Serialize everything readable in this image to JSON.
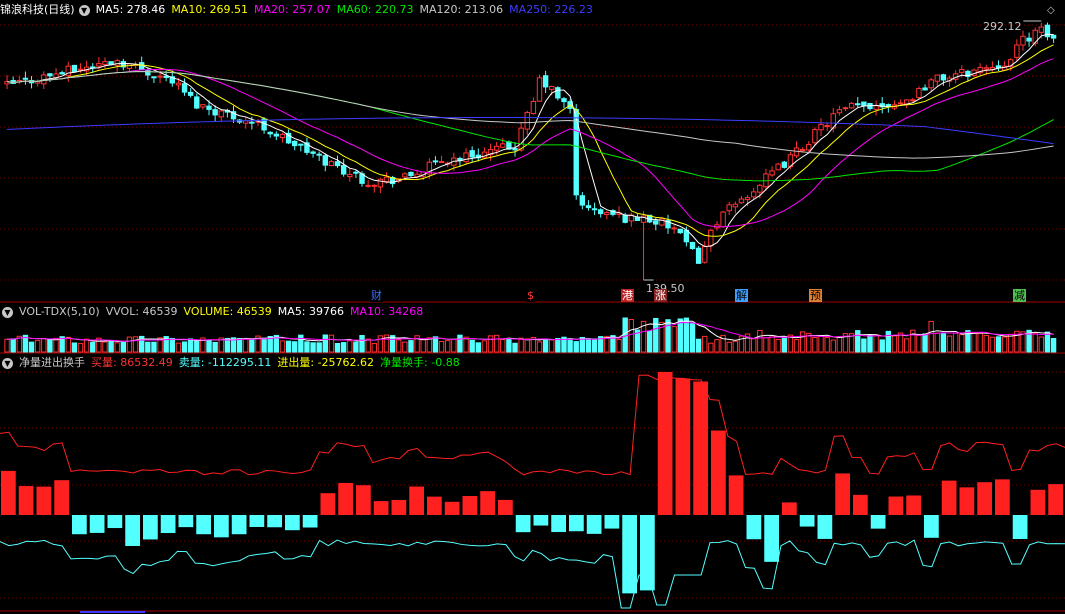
{
  "main_header": {
    "stock_name": "锦浪科技(日线)",
    "ma5": "MA5: 278.46",
    "ma10": "MA10: 269.51",
    "ma20": "MA20: 257.07",
    "ma60": "MA60: 220.73",
    "ma120": "MA120: 213.06",
    "ma250": "MA250: 226.23",
    "high_price": "292.12",
    "low_price": "139.50"
  },
  "vol_header": {
    "name": "VOL-TDX(5,10)",
    "vvol": "VVOL: 46539",
    "volume": "VOLUME: 46539",
    "ma5": "MA5: 39766",
    "ma10": "MA10: 34268"
  },
  "ind_header": {
    "name": "净量进出换手",
    "buy": "买量: 86532.49",
    "sell": "卖量: -112295.11",
    "net": "进出量: -25762.62",
    "turnover": "净量换手: -0.88"
  },
  "event_tags": [
    {
      "label": "财",
      "color": "#3c6cff",
      "bg": "#000000"
    },
    {
      "label": "$",
      "color": "#ff3c3c",
      "bg": "#000000"
    },
    {
      "label": "港",
      "color": "#ffffff",
      "bg": "#c02020"
    },
    {
      "label": "涨",
      "color": "#ffffff",
      "bg": "#8a2020"
    },
    {
      "label": "解",
      "color": "#000000",
      "bg": "#40a0ff"
    },
    {
      "label": "预",
      "color": "#000000",
      "bg": "#e08030"
    },
    {
      "label": "减",
      "color": "#000000",
      "bg": "#50c050"
    }
  ],
  "colors": {
    "up": "#ff3232",
    "down": "#54ffff",
    "ma5": "#ffffff",
    "ma10": "#ffff00",
    "ma20": "#ff00ff",
    "ma60": "#00e600",
    "ma120": "#c8c8c8",
    "ma250": "#3c3cff",
    "grid": "#6e0000"
  },
  "chart_data": [
    {
      "type": "candlestick",
      "title": "锦浪科技(日线)",
      "ylim": [
        139.5,
        292.12
      ],
      "series": [
        {
          "name": "MA5",
          "last": 278.46
        },
        {
          "name": "MA10",
          "last": 269.51
        },
        {
          "name": "MA20",
          "last": 257.07
        },
        {
          "name": "MA60",
          "last": 220.73
        },
        {
          "name": "MA120",
          "last": 213.06
        },
        {
          "name": "MA250",
          "last": 226.23
        }
      ],
      "high": 292.12,
      "low": 139.5,
      "grid": true
    },
    {
      "type": "bar",
      "title": "VOL-TDX(5,10)",
      "series": [
        {
          "name": "VOLUME",
          "last": 46539
        },
        {
          "name": "MA5",
          "last": 39766
        },
        {
          "name": "MA10",
          "last": 34268
        }
      ]
    },
    {
      "type": "bar",
      "title": "净量进出换手",
      "series": [
        {
          "name": "买量",
          "last": 86532.49
        },
        {
          "name": "卖量",
          "last": -112295.11
        },
        {
          "name": "进出量",
          "last": -25762.62
        },
        {
          "name": "净量换手",
          "last": -0.88
        }
      ]
    }
  ]
}
